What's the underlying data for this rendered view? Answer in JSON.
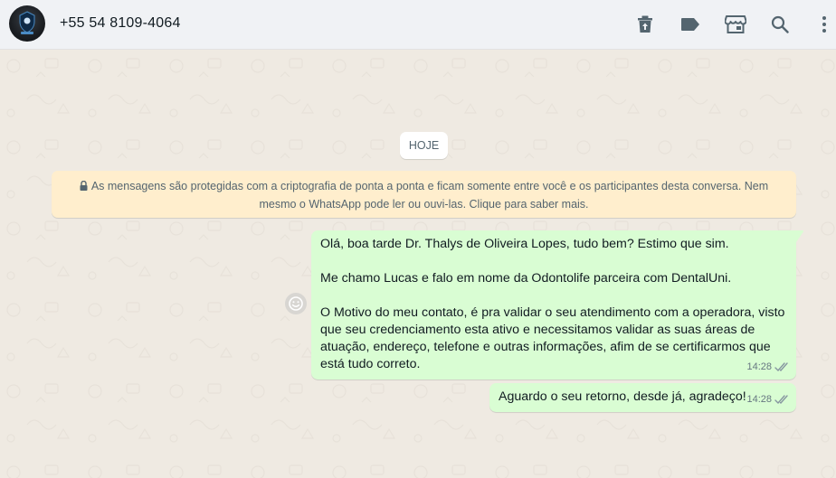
{
  "header": {
    "contact_name": "+55 54 8109-4064",
    "icons": [
      "delete-icon",
      "label-icon",
      "store-icon",
      "search-icon",
      "menu-icon"
    ]
  },
  "chat": {
    "date_chip": "HOJE",
    "encryption_notice": "As mensagens são protegidas com a criptografia de ponta a ponta e ficam somente entre você e os participantes desta conversa. Nem mesmo o WhatsApp pode ler ou ouvi-las. Clique para saber mais.",
    "messages": [
      {
        "paragraphs": [
          "Olá, boa tarde Dr. Thalys de Oliveira Lopes, tudo bem? Estimo que sim.",
          "Me chamo Lucas e falo em nome da Odontolife parceira com DentalUni.",
          "O Motivo do meu contato, é pra validar o seu atendimento com a operadora, visto que seu credenciamento esta ativo e necessitamos validar as suas áreas de atuação, endereço, telefone e outras informações, afim de se certificarmos que está tudo correto."
        ],
        "time": "14:28",
        "status": "read"
      },
      {
        "paragraphs": [
          "Aguardo o seu retorno, desde já, agradeço!"
        ],
        "time": "14:28",
        "status": "read"
      }
    ]
  },
  "colors": {
    "header_bg": "#f0f2f5",
    "chat_bg": "#efeae2",
    "outgoing_bubble": "#d9fdd3",
    "notice_bg": "#ffeecd",
    "icon": "#54656f",
    "check_read": "#8696a0"
  }
}
